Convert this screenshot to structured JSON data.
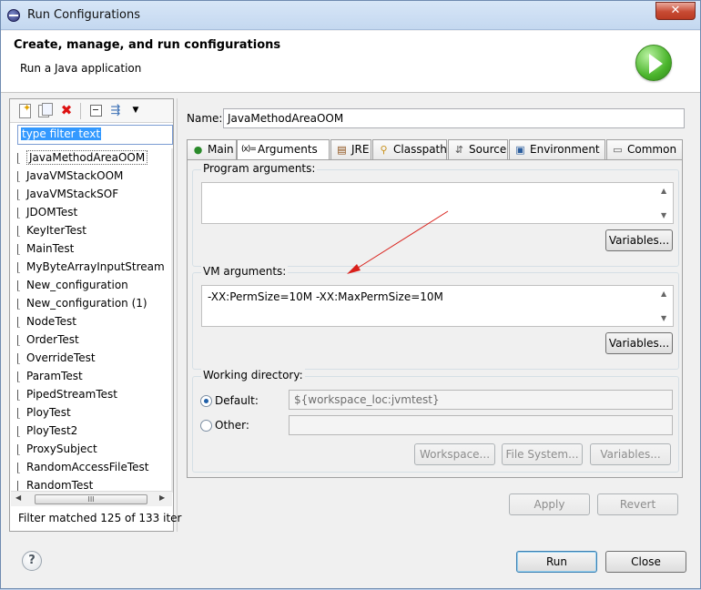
{
  "window": {
    "title": "Run Configurations",
    "close_glyph": "✕"
  },
  "header": {
    "title": "Create, manage, and run configurations",
    "subtitle": "Run a Java application"
  },
  "left": {
    "filter_placeholder": "type filter text",
    "items": [
      "JavaMethodAreaOOM",
      "JavaVMStackOOM",
      "JavaVMStackSOF",
      "JDOMTest",
      "KeyIterTest",
      "MainTest",
      "MyByteArrayInputStream",
      "New_configuration",
      "New_configuration (1)",
      "NodeTest",
      "OrderTest",
      "OverrideTest",
      "ParamTest",
      "PipedStreamTest",
      "PloyTest",
      "PloyTest2",
      "ProxySubject",
      "RandomAccessFileTest",
      "RandomTest"
    ],
    "selected_index": 0,
    "status": "Filter matched 125 of 133 iter",
    "scroll_thumb": "III"
  },
  "right": {
    "name_label": "Name:",
    "name_value": "JavaMethodAreaOOM",
    "tabs": [
      {
        "label": "Main",
        "icon": "main-icon"
      },
      {
        "label": "Arguments",
        "icon": "arguments-icon"
      },
      {
        "label": "JRE",
        "icon": "jre-icon"
      },
      {
        "label": "Classpath",
        "icon": "classpath-icon"
      },
      {
        "label": "Source",
        "icon": "source-icon"
      },
      {
        "label": "Environment",
        "icon": "environment-icon"
      },
      {
        "label": "Common",
        "icon": "common-icon"
      }
    ],
    "active_tab": "Arguments",
    "program_args": {
      "title": "Program arguments:",
      "value": "",
      "variables": "Variables..."
    },
    "vm_args": {
      "title": "VM arguments:",
      "value": "-XX:PermSize=10M -XX:MaxPermSize=10M",
      "variables": "Variables..."
    },
    "working_dir": {
      "title": "Working directory:",
      "default_label": "Default:",
      "default_value": "${workspace_loc:jvmtest}",
      "other_label": "Other:",
      "other_value": "",
      "buttons": [
        "Workspace...",
        "File System...",
        "Variables..."
      ]
    },
    "apply": "Apply",
    "revert": "Revert"
  },
  "footer": {
    "help": "?",
    "run": "Run",
    "close": "Close"
  },
  "colors": {
    "annotation_arrow": "#d9201a",
    "selection": "#3399ff"
  }
}
